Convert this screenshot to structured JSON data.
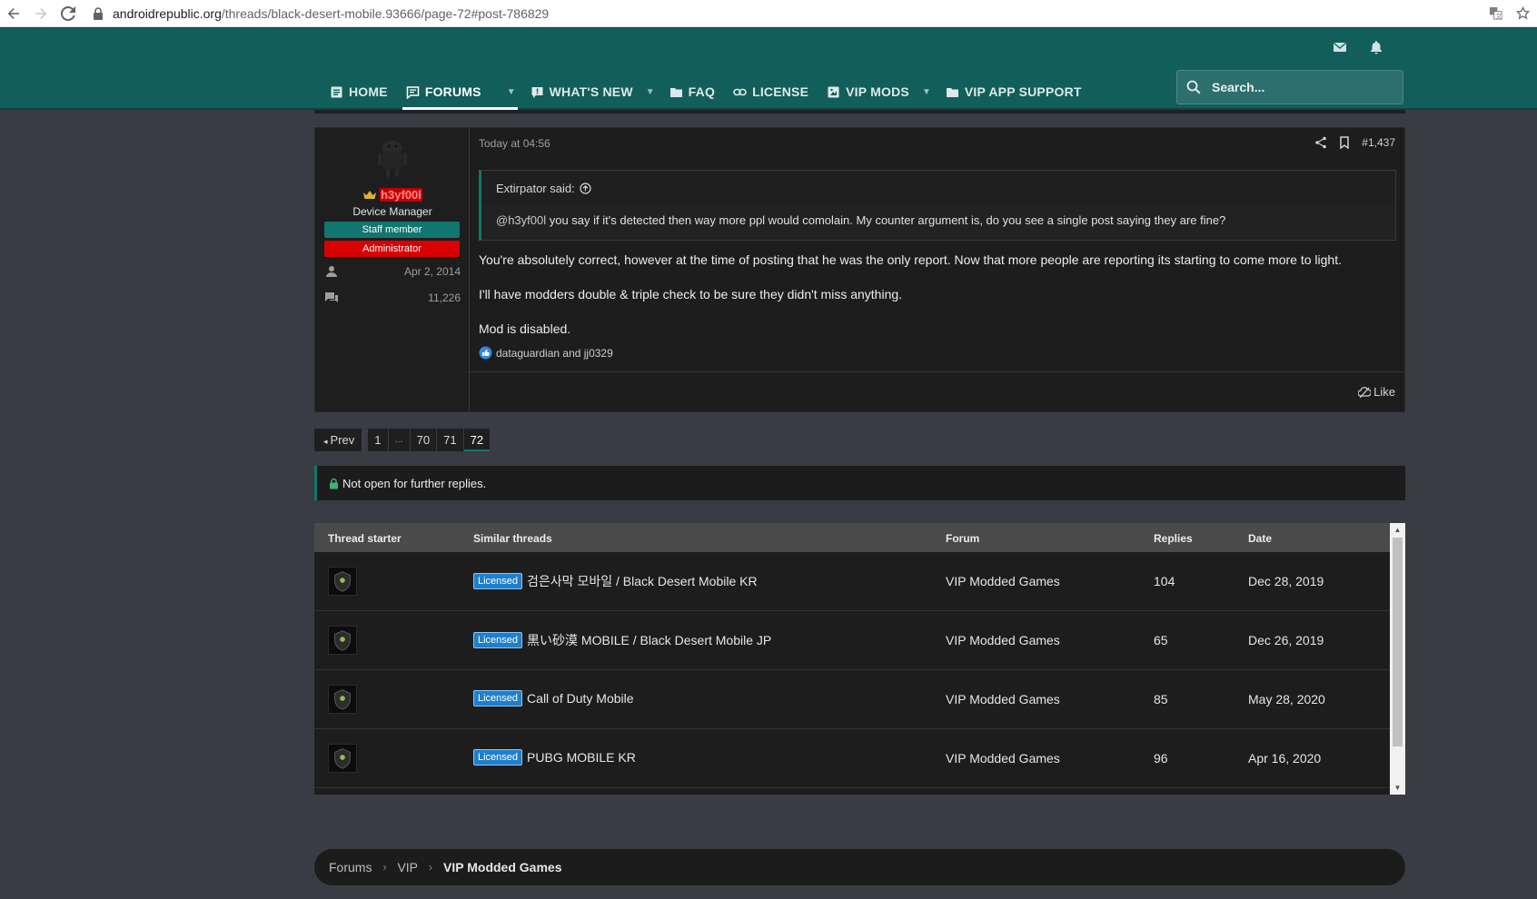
{
  "browser": {
    "url_host": "androidrepublic.org",
    "url_path": "/threads/black-desert-mobile.93666/page-72#post-786829"
  },
  "nav": {
    "items": [
      {
        "label": "HOME",
        "icon": "home-icon"
      },
      {
        "label": "FORUMS",
        "icon": "forums-icon",
        "active": true,
        "has_menu": true
      },
      {
        "label": "WHAT'S NEW",
        "icon": "whats-new-icon",
        "has_menu": true
      },
      {
        "label": "FAQ",
        "icon": "folder-icon"
      },
      {
        "label": "LICENSE",
        "icon": "link-icon"
      },
      {
        "label": "VIP MODS",
        "icon": "vip-mods-icon",
        "has_menu": true
      },
      {
        "label": "VIP APP SUPPORT",
        "icon": "folder-icon"
      }
    ],
    "search_placeholder": "Search..."
  },
  "post": {
    "user": {
      "name": "h3yf00l",
      "title": "Device Manager",
      "banners": [
        "Staff member",
        "Administrator"
      ],
      "joined": "Apr 2, 2014",
      "messages": "11,226"
    },
    "date": "Today at 04:56",
    "post_number": "#1,437",
    "quote": {
      "author": "Extirpator said:",
      "mention": "@h3yf00l",
      "text": " you say if it's detected then way more ppl would comolain. My counter argument is, do you see a single post saying they are fine?"
    },
    "paragraphs": [
      "You're absolutely correct, however at the time of posting that he was the only report. Now that more people are reporting its starting to come more to light.",
      "I'll have modders double & triple check to be sure they didn't miss anything.",
      "Mod is disabled."
    ],
    "reactions": "dataguardian and jj0329",
    "like_label": "Like"
  },
  "pagination": {
    "prev": "Prev",
    "pages": [
      "1",
      "...",
      "70",
      "71",
      "72"
    ],
    "current": "72"
  },
  "notice": "Not open for further replies.",
  "similar_threads": {
    "headers": [
      "Thread starter",
      "Similar threads",
      "Forum",
      "Replies",
      "Date"
    ],
    "rows": [
      {
        "prefix": "Licensed",
        "title": "검은사막 모바일 / Black Desert Mobile KR",
        "forum": "VIP Modded Games",
        "replies": "104",
        "date": "Dec 28, 2019"
      },
      {
        "prefix": "Licensed",
        "title": "黒い砂漠 MOBILE / Black Desert Mobile JP",
        "forum": "VIP Modded Games",
        "replies": "65",
        "date": "Dec 26, 2019"
      },
      {
        "prefix": "Licensed",
        "title": "Call of Duty Mobile",
        "forum": "VIP Modded Games",
        "replies": "85",
        "date": "May 28, 2020"
      },
      {
        "prefix": "Licensed",
        "title": "PUBG MOBILE KR",
        "forum": "VIP Modded Games",
        "replies": "96",
        "date": "Apr 16, 2020"
      }
    ]
  },
  "breadcrumb": [
    "Forums",
    "VIP",
    "VIP Modded Games"
  ],
  "colors": {
    "header": "#125e5b",
    "accent": "#13756f",
    "admin": "#d90000",
    "prefix": "#1f7fcc"
  }
}
